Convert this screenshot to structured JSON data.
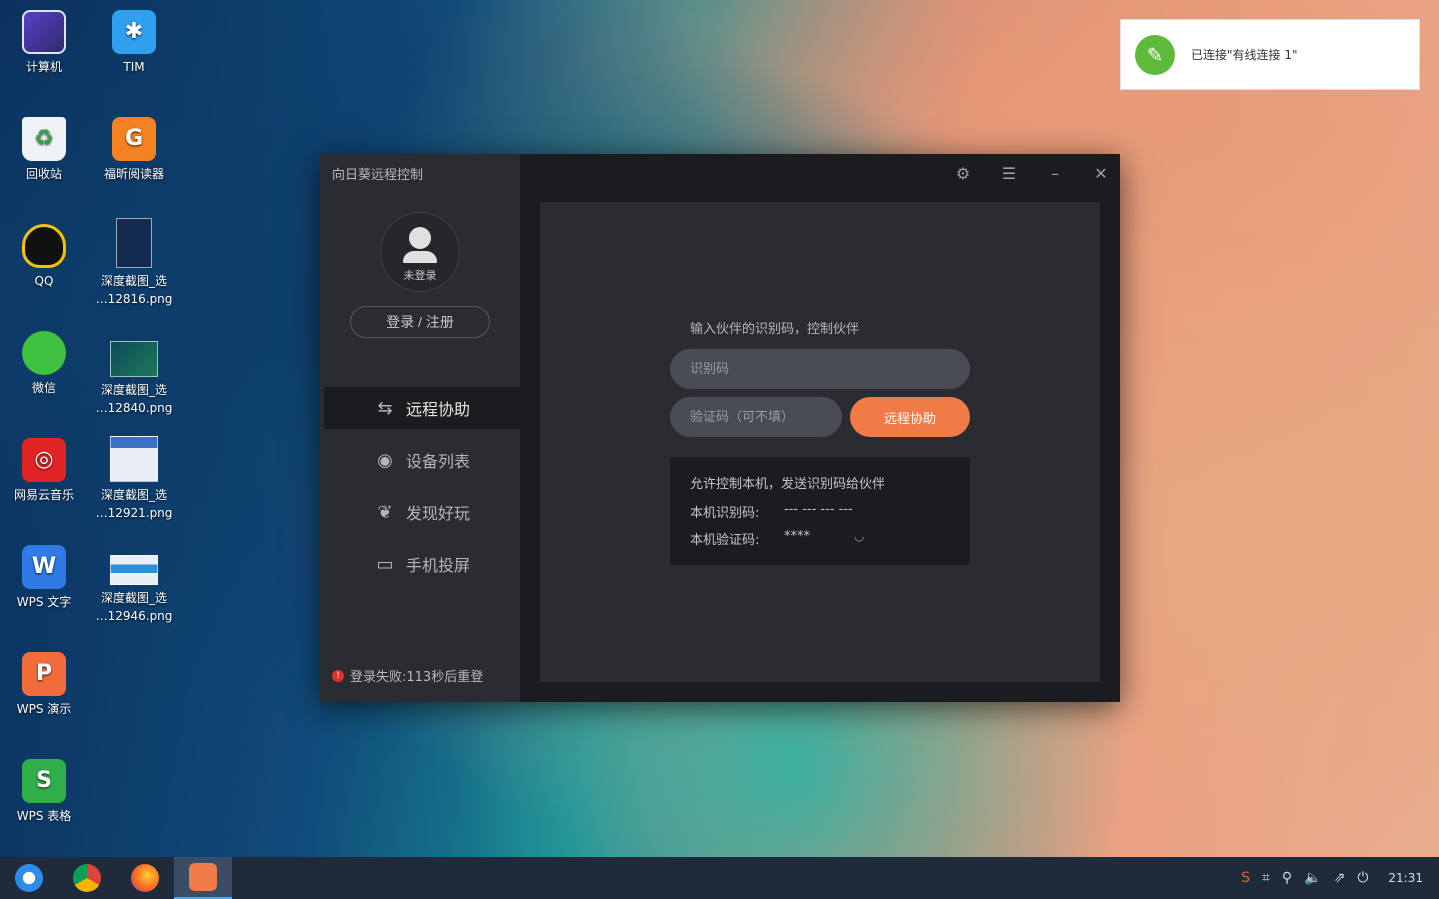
{
  "desktop": {
    "icons": [
      {
        "label": "计算机",
        "icon": "computer-icon"
      },
      {
        "label": "TIM",
        "icon": "tim-icon"
      },
      {
        "label": "回收站",
        "icon": "trash-icon"
      },
      {
        "label": "福昕阅读器",
        "icon": "foxit-reader-icon"
      },
      {
        "label": "QQ",
        "icon": "qq-icon"
      },
      {
        "label": "深度截图_选\n…12816.png",
        "icon": "screenshot-file-icon"
      },
      {
        "label": "微信",
        "icon": "wechat-icon"
      },
      {
        "label": "深度截图_选\n…12840.png",
        "icon": "screenshot-file-icon"
      },
      {
        "label": "网易云音乐",
        "icon": "netease-music-icon"
      },
      {
        "label": "深度截图_选\n…12921.png",
        "icon": "screenshot-file-icon"
      },
      {
        "label": "WPS 文字",
        "icon": "wps-writer-icon"
      },
      {
        "label": "深度截图_选\n…12946.png",
        "icon": "screenshot-file-icon"
      },
      {
        "label": "WPS 演示",
        "icon": "wps-presentation-icon"
      },
      {
        "label": "WPS 表格",
        "icon": "wps-spreadsheet-icon"
      }
    ]
  },
  "notification": {
    "text": "已连接\"有线连接 1\""
  },
  "app": {
    "title": "向日葵远程控制",
    "avatar_label": "未登录",
    "login_button": "登录 / 注册",
    "nav": [
      {
        "label": "远程协助",
        "icon": "remote-assist-icon"
      },
      {
        "label": "设备列表",
        "icon": "device-list-icon"
      },
      {
        "label": "发现好玩",
        "icon": "discover-icon"
      },
      {
        "label": "手机投屏",
        "icon": "screen-cast-icon"
      }
    ],
    "error": "登录失败:113秒后重登",
    "panel": {
      "hint": "输入伙伴的识别码，控制伙伴",
      "id_placeholder": "识别码",
      "code_placeholder": "验证码（可不填）",
      "primary_button": "远程协助",
      "info_title": "允许控制本机，发送识别码给伙伴",
      "local_id_label": "本机识别码:",
      "local_id_value": "--- --- --- ---",
      "local_code_label": "本机验证码:",
      "local_code_value": "****"
    }
  },
  "taskbar": {
    "clock": "21:31"
  },
  "colors": {
    "accent": "#f07b47",
    "sidebar": "#2a2c31",
    "window": "#1b1c20"
  }
}
